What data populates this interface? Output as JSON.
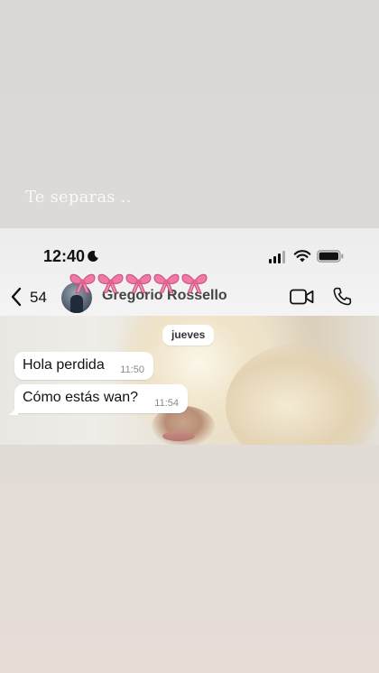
{
  "story": {
    "caption": "Te separas .."
  },
  "status_bar": {
    "time": "12:40"
  },
  "chat_header": {
    "back_count": "54",
    "contact_name": "Gregorio Rossello",
    "sticker": "pink-bows-sticker"
  },
  "chat": {
    "day_label": "jueves",
    "messages": [
      {
        "text": "Hola perdida",
        "time": "11:50",
        "direction": "incoming"
      },
      {
        "text": "Cómo estás wan?",
        "time": "11:54",
        "direction": "incoming"
      }
    ]
  },
  "colors": {
    "bubble": "#ffffff",
    "caption": "#fbfbfb",
    "bow": "#f07aa6"
  }
}
